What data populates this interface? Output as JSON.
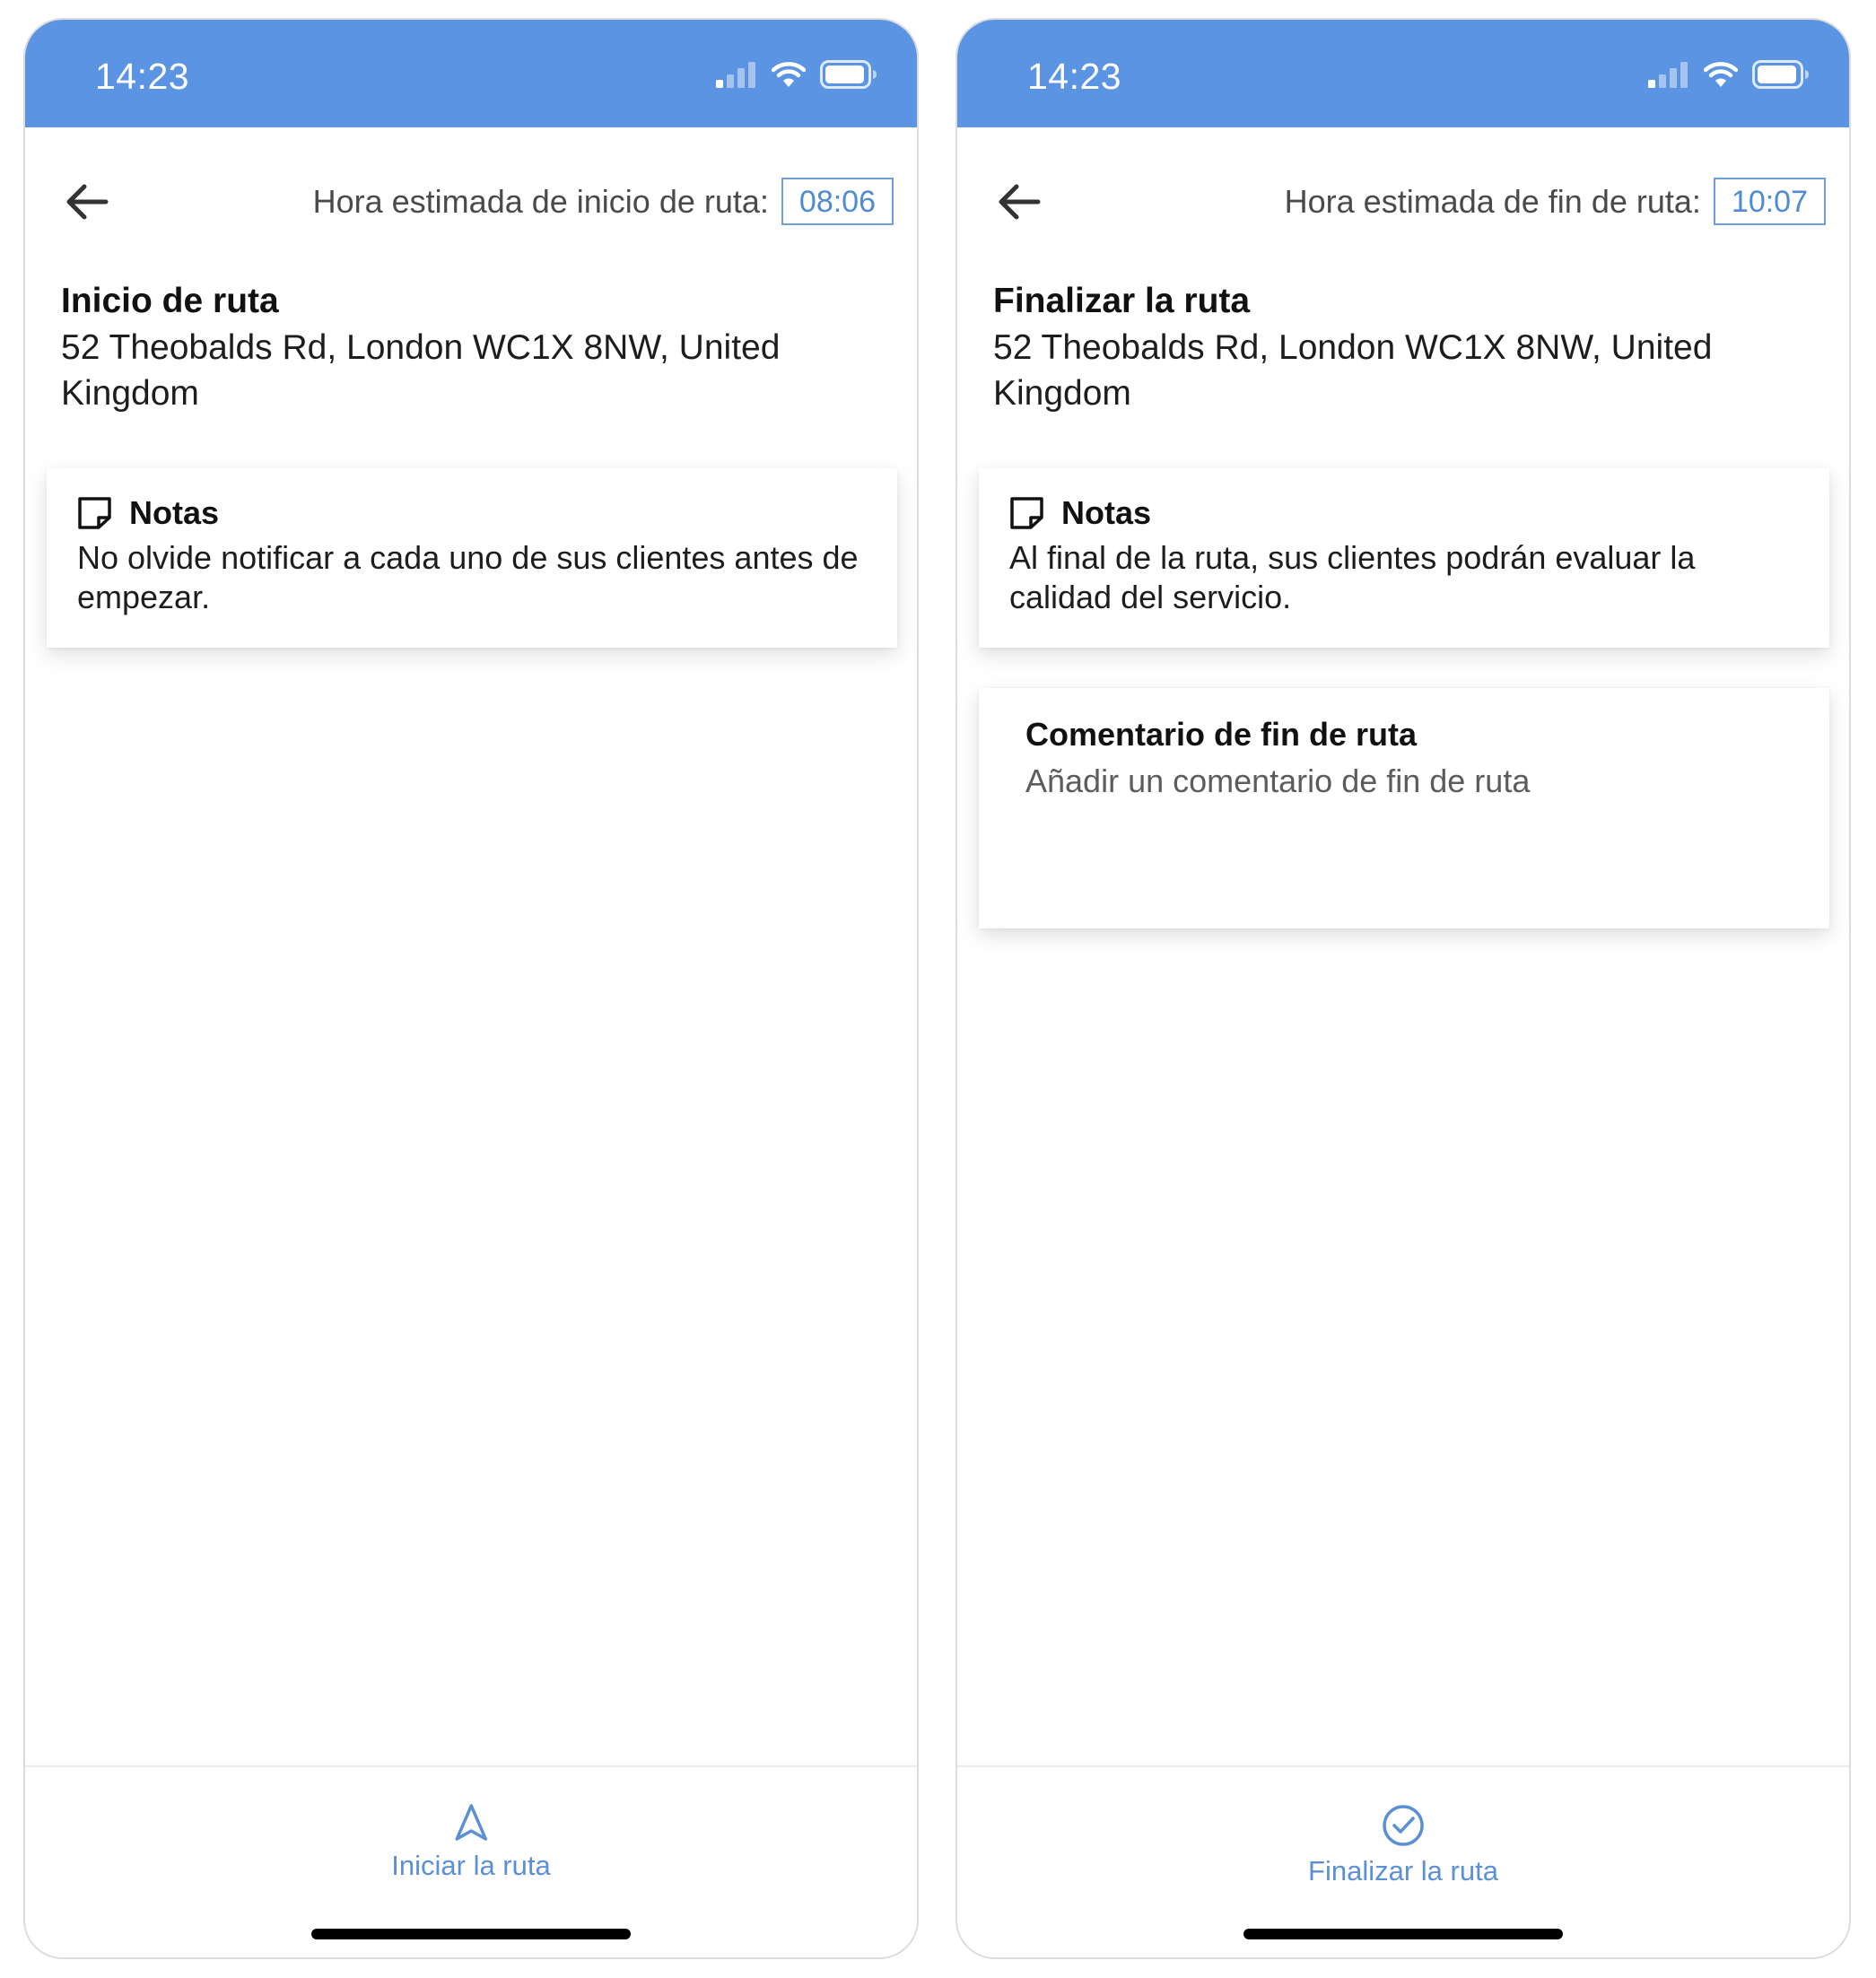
{
  "colors": {
    "accent": "#5b94e3",
    "link": "#5b8fd6",
    "time_box": "#6f9ed9"
  },
  "screens": [
    {
      "status": {
        "time": "14:23"
      },
      "eta": {
        "label": "Hora estimada de inicio de ruta:",
        "time": "08:06"
      },
      "stop": {
        "title": "Inicio de ruta",
        "address": "52 Theobalds Rd, London WC1X 8NW, United Kingdom"
      },
      "notes": {
        "title": "Notas",
        "text": "No olvide notificar a cada uno de sus clientes antes de empezar."
      },
      "action": {
        "label": "Iniciar la ruta",
        "icon": "navigation-arrow-icon"
      }
    },
    {
      "status": {
        "time": "14:23"
      },
      "eta": {
        "label": "Hora estimada de fin de ruta:",
        "time": "10:07"
      },
      "stop": {
        "title": "Finalizar la ruta",
        "address": "52 Theobalds Rd, London WC1X 8NW, United Kingdom"
      },
      "notes": {
        "title": "Notas",
        "text": "Al final de la ruta, sus clientes podrán evaluar la calidad del servicio."
      },
      "comment": {
        "title": "Comentario de fin de ruta",
        "placeholder": "Añadir un comentario de fin de ruta"
      },
      "action": {
        "label": "Finalizar la ruta",
        "icon": "check-circle-icon"
      }
    }
  ]
}
